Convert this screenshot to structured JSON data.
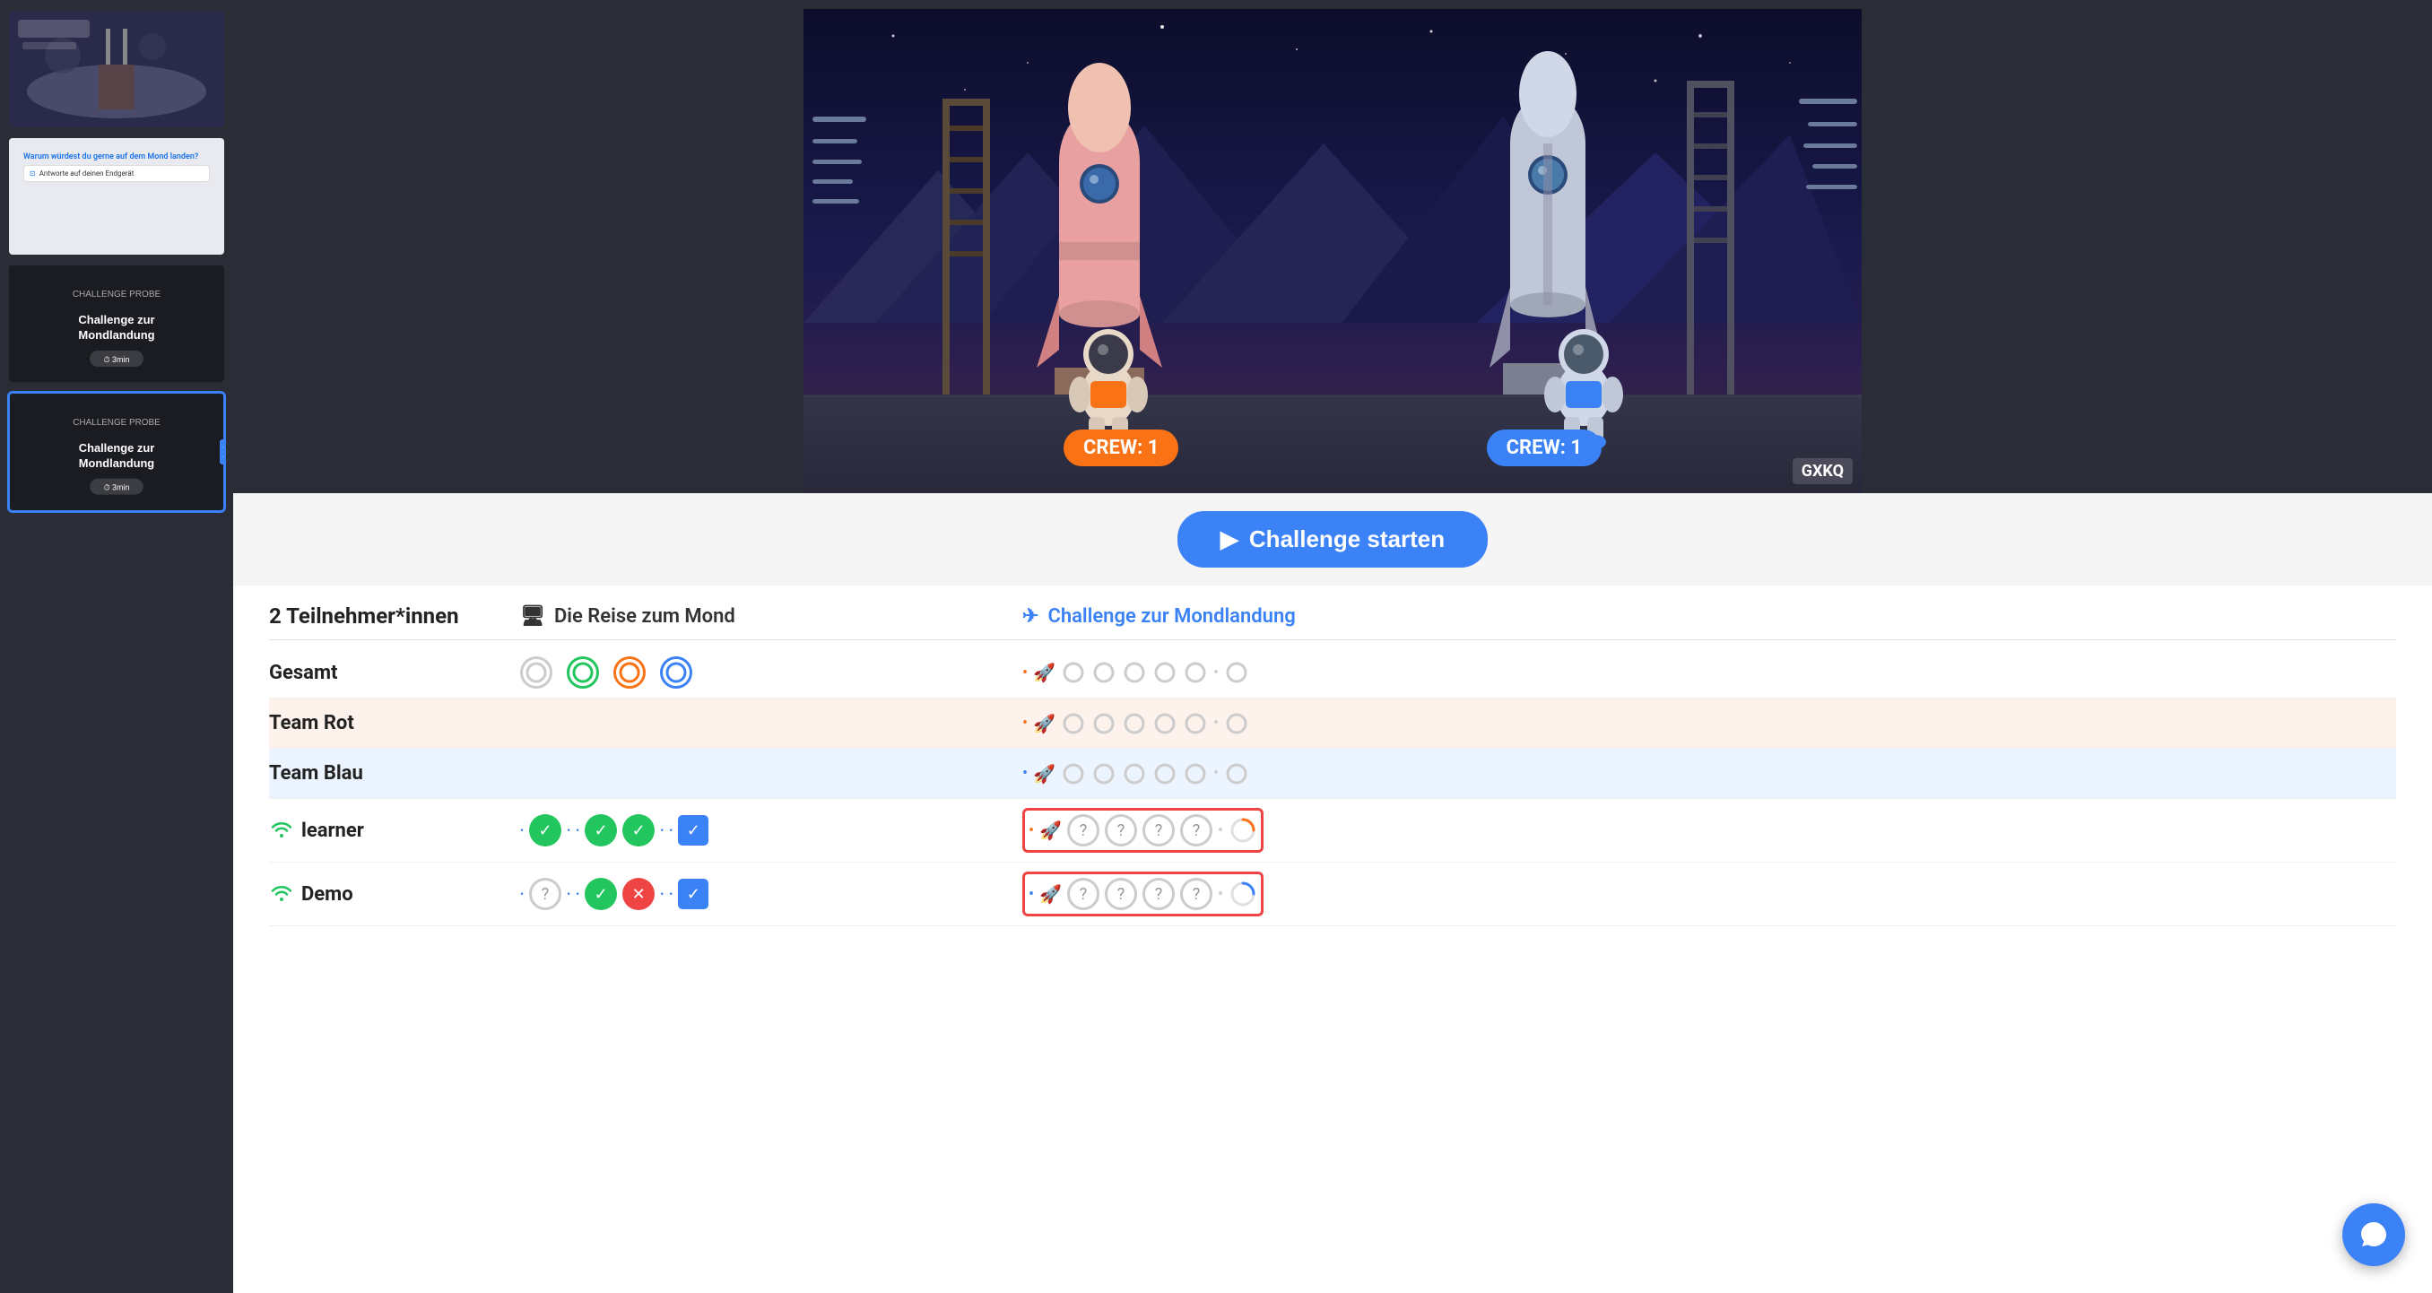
{
  "sidebar": {
    "slides": [
      {
        "id": "slide-1",
        "type": "moon",
        "active": false,
        "label": "Moon surface"
      },
      {
        "id": "slide-2",
        "type": "question",
        "active": false,
        "label": "Warum würdest du gerne auf dem Mond landen?",
        "sub": "Antworte auf deinen Endgerät"
      },
      {
        "id": "slide-3",
        "type": "challenge-dark",
        "active": false,
        "title": "CHALLENGE PROBE",
        "label": "Challenge zur Mondlandung",
        "duration": "3min"
      },
      {
        "id": "slide-4",
        "type": "challenge-dark",
        "active": true,
        "title": "CHALLENGE PROBE",
        "label": "Challenge zur Mondlandung",
        "duration": "3min"
      }
    ]
  },
  "stage": {
    "crew_left": "CREW: 1",
    "crew_right": "CREW: 1",
    "code": "GXKQ"
  },
  "start_button": {
    "label": "Challenge starten"
  },
  "stats": {
    "header_participants": "2 Teilnehmer*innen",
    "header_mid_label": "Die Reise zum Mond",
    "header_right_label": "Challenge zur Mondlandung",
    "rows": [
      {
        "label": "Gesamt",
        "type": "gesamt",
        "mid_icons": [
          "ring-gray",
          "ring-green",
          "ring-orange",
          "ring-blue"
        ],
        "right_icons": [
          "dot-orange",
          "rocket",
          "ring",
          "ring",
          "ring",
          "ring",
          "ring",
          "dot-gray",
          "ring-gray"
        ]
      },
      {
        "label": "Team Rot",
        "type": "team-rot",
        "mid_icons": [],
        "right_icons": [
          "dot-orange",
          "rocket-orange",
          "ring",
          "ring",
          "ring",
          "ring",
          "ring",
          "dot-gray",
          "ring-gray"
        ]
      },
      {
        "label": "Team Blau",
        "type": "team-blau",
        "mid_icons": [],
        "right_icons": [
          "dot-blue",
          "rocket-blue",
          "ring",
          "ring",
          "ring",
          "ring",
          "ring",
          "dot-gray",
          "ring-gray"
        ]
      },
      {
        "label": "learner",
        "type": "learner",
        "wifi": true,
        "mid_icons": [
          "dot-blue",
          "check-green",
          "dot-blue",
          "dot-blue",
          "check-green",
          "check-green",
          "dot-blue",
          "dot-blue",
          "checkbox-blue"
        ],
        "right_icons": [
          "dot-orange",
          "rocket-orange",
          "question",
          "question",
          "question",
          "question",
          "dot-gray",
          "ring-partial"
        ],
        "highlighted": true
      },
      {
        "label": "Demo",
        "type": "demo",
        "wifi": true,
        "mid_icons": [
          "dot-blue",
          "question-circle",
          "dot-blue",
          "dot-blue",
          "check-green",
          "x-red",
          "dot-blue",
          "dot-blue",
          "checkbox-blue"
        ],
        "right_icons": [
          "dot-blue",
          "rocket-blue",
          "question",
          "question",
          "question",
          "question",
          "dot-gray",
          "ring-partial"
        ],
        "highlighted": true
      }
    ]
  },
  "chat": {
    "icon": "chat-icon"
  }
}
